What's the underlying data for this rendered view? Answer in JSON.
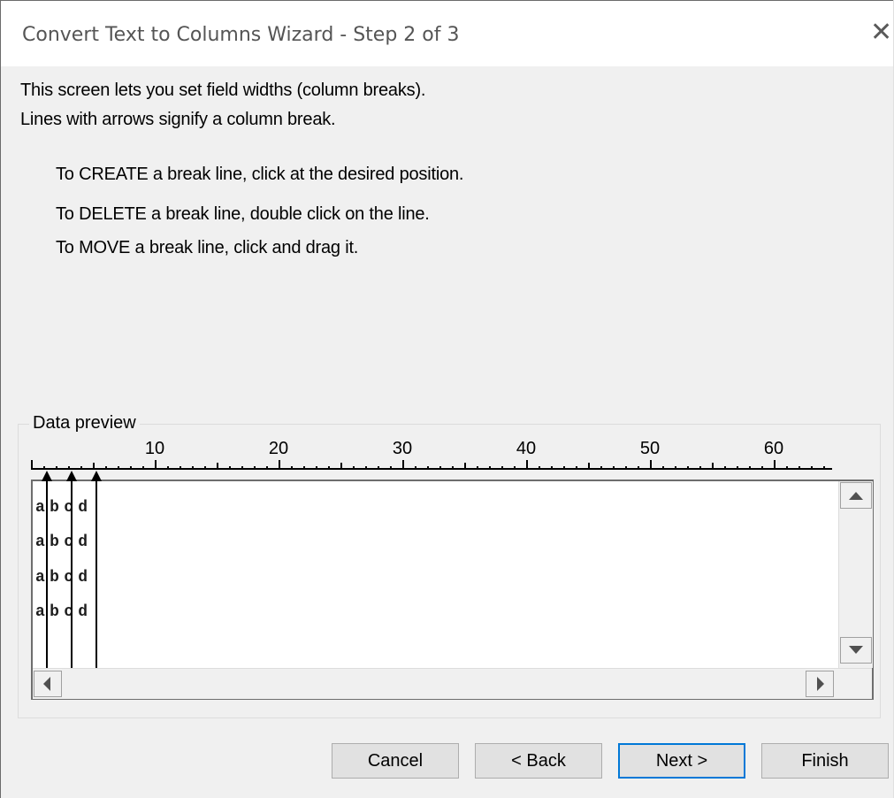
{
  "window": {
    "title": "Convert Text to Columns Wizard - Step 2 of 3",
    "close_glyph": "✕"
  },
  "intro": {
    "line1": "This screen lets you set field widths (column breaks).",
    "line2": "Lines with arrows signify a column break."
  },
  "instructions": {
    "create": "To CREATE a break line, click at the desired position.",
    "delete": "To DELETE a break line, double click on the line.",
    "move": "To MOVE a break line, click and drag it."
  },
  "preview": {
    "label": "Data preview",
    "ruler_numbers": [
      "10",
      "20",
      "30",
      "40",
      "50",
      "60"
    ],
    "rows": [
      "abcd",
      "abcd",
      "abcd",
      "abcd"
    ],
    "column_breaks": [
      1,
      3,
      5
    ]
  },
  "scroll_icons": {
    "up": "scroll-up-arrow",
    "down": "scroll-down-arrow",
    "left": "scroll-left-arrow",
    "right": "scroll-right-arrow"
  },
  "buttons": {
    "cancel": "Cancel",
    "back": "< Back",
    "next": "Next >",
    "finish": "Finish"
  },
  "colors": {
    "default_button_border": "#0078d7",
    "dialog_background": "#f0f0f0"
  }
}
